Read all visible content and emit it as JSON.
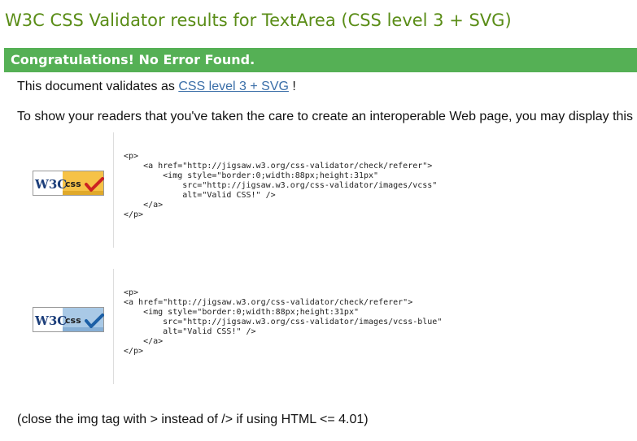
{
  "header": {
    "title": "W3C CSS Validator results for TextArea (CSS level 3 + SVG)"
  },
  "banner": {
    "text": "Congratulations! No Error Found."
  },
  "validation": {
    "prefix": "This document validates as ",
    "link_text": "CSS level 3 + SVG",
    "suffix": " !"
  },
  "readers_note": "To show your readers that you've taken the care to create an interoperable Web page, you may display this",
  "badges": [
    {
      "logo_text": "W3C",
      "badge_text": "css",
      "style": "gold",
      "snippet": "<p>\n    <a href=\"http://jigsaw.w3.org/css-validator/check/referer\">\n        <img style=\"border:0;width:88px;height:31px\"\n            src=\"http://jigsaw.w3.org/css-validator/images/vcss\"\n            alt=\"Valid CSS!\" />\n    </a>\n</p>"
    },
    {
      "logo_text": "W3C",
      "badge_text": "css",
      "style": "blue",
      "snippet": "<p>\n<a href=\"http://jigsaw.w3.org/css-validator/check/referer\">\n    <img style=\"border:0;width:88px;height:31px\"\n        src=\"http://jigsaw.w3.org/css-validator/images/vcss-blue\"\n        alt=\"Valid CSS!\" />\n    </a>\n</p>"
    }
  ],
  "footer_note": "(close the img tag with > instead of /> if using HTML <= 4.01)",
  "colors": {
    "title_green": "#5a8d17",
    "banner_green": "#55b055",
    "link_blue": "#3a6ea8",
    "badge_gold": "#f6c247",
    "badge_blue": "#a9c9e6",
    "check_red": "#cc2222",
    "check_blue": "#1b5fa6",
    "logo_navy": "#1c3e7a"
  }
}
